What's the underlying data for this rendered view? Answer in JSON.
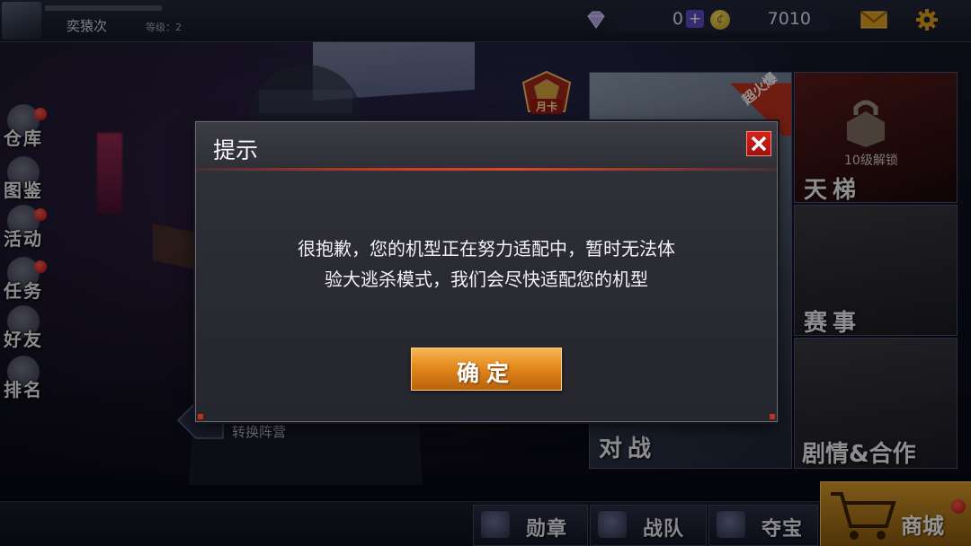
{
  "player": {
    "name": "奕猿次",
    "level_label": "等级：2"
  },
  "currency": {
    "diamonds": "0",
    "coins": "7010",
    "coin_symbol": "¢"
  },
  "left_menu": [
    {
      "label": "仓库",
      "badge": true
    },
    {
      "label": "图鉴",
      "badge": false
    },
    {
      "label": "活动",
      "badge": true
    },
    {
      "label": "任务",
      "badge": true
    },
    {
      "label": "好友",
      "badge": false
    },
    {
      "label": "排名",
      "badge": false
    }
  ],
  "month_card": {
    "label": "月卡"
  },
  "modes": {
    "hot_badge": "超火爆",
    "battle": "对战",
    "ladder": "天梯",
    "ladder_unlock": "10级解锁",
    "tournament": "赛事",
    "story": "剧情&合作"
  },
  "switch_camp": "转换阵营",
  "bottom_nav": [
    {
      "label": "勋章"
    },
    {
      "label": "战队"
    },
    {
      "label": "夺宝"
    }
  ],
  "shop": {
    "label": "商城"
  },
  "dialog": {
    "title": "提示",
    "message_line1": "很抱歉，您的机型正在努力适配中，暂时无法体",
    "message_line2": "验大逃杀模式，我们会尽快适配您的机型",
    "confirm_label": "确定"
  },
  "colors": {
    "accent_red": "#d23a22",
    "button_orange": "#e38a1c",
    "badge_red": "#d8231c"
  }
}
